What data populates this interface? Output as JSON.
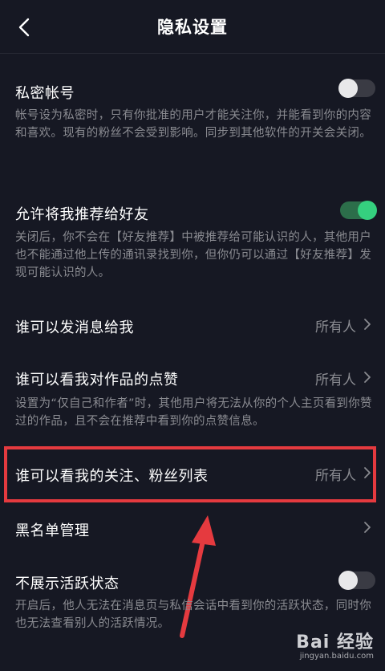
{
  "header": {
    "title": "隐私设置"
  },
  "private_account": {
    "label": "私密帐号",
    "desc": "帐号设为私密时，只有你批准的用户才能关注你，并能看到你的内容和喜欢。现有的粉丝不会受到影响。同步到其他软件的开关会关闭。",
    "enabled": false
  },
  "recommend_friends": {
    "label": "允许将我推荐给好友",
    "desc": "关闭后，你不会在【好友推荐】中被推荐给可能认识的人，其他用户也不能通过他上传的通讯录找到你，但你仍可以通过【好友推荐】发现可能认识的人。",
    "enabled": true
  },
  "message_me": {
    "label": "谁可以发消息给我",
    "value": "所有人"
  },
  "likes_visibility": {
    "label": "谁可以看我对作品的点赞",
    "value": "所有人",
    "desc": "设置为“仅自己和作者”时，其他用户将无法从你的个人主页看到你赞过的作品，且不会在推荐中看到你的点赞信息。"
  },
  "follow_list": {
    "label": "谁可以看我的关注、粉丝列表",
    "value": "所有人"
  },
  "blacklist": {
    "label": "黑名单管理"
  },
  "activity_status": {
    "label": "不展示活跃状态",
    "desc": "开启后，他人无法在消息页与私信会话中看到你的活跃状态，同时你也无法查看别人的活跃情况。",
    "enabled": false
  },
  "watermark": {
    "logo": "Bai 经验",
    "sub": "jingyan.baidu.com"
  },
  "colors": {
    "background": "#161823",
    "toggle_on": "#35d07f",
    "highlight": "#e53a3f",
    "secondary_text": "#8a8b91"
  }
}
